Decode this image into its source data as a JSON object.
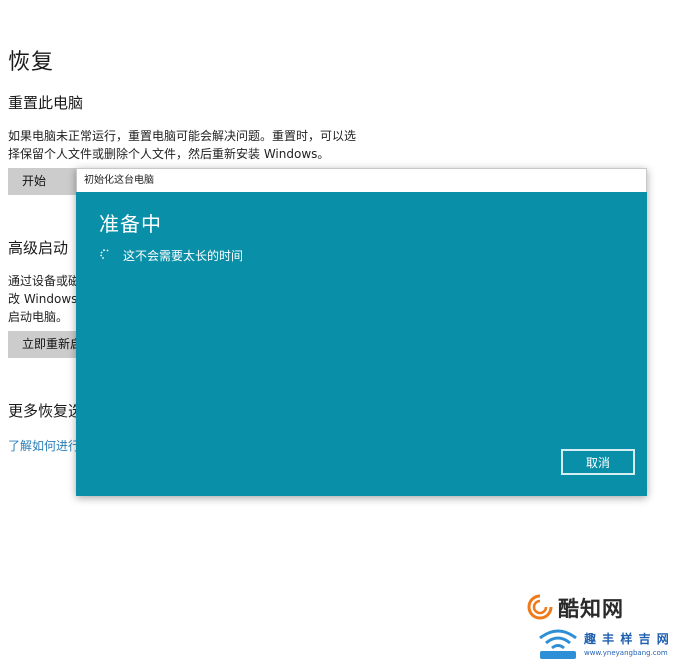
{
  "page": {
    "title": "恢复"
  },
  "reset_pc": {
    "title": "重置此电脑",
    "description_line1": "如果电脑未正常运行，重置电脑可能会解决问题。重置时，可以选",
    "description_line2": "择保留个人文件或删除个人文件，然后重新安装 Windows。",
    "button_label": "开始"
  },
  "advanced_startup": {
    "title": "高级启动",
    "description_line1": "通过设备或磁",
    "description_line2": "改 Windows",
    "description_line3": "启动电脑。",
    "button_label": "立即重新启"
  },
  "more_recovery": {
    "title": "更多恢复选",
    "link_label": "了解如何进行"
  },
  "dialog": {
    "window_title": "初始化这台电脑",
    "heading": "准备中",
    "status": "这不会需要太长的时间",
    "cancel_label": "取消"
  },
  "watermarks": {
    "brand1": "酷知网",
    "brand2": "趣 丰 样 吉 网",
    "brand2_url": "www.yneyangbang.com"
  },
  "colors": {
    "dialog_background": "#0a8fa8",
    "button_gray": "#cccccc",
    "link_blue": "#2a7fb8"
  }
}
